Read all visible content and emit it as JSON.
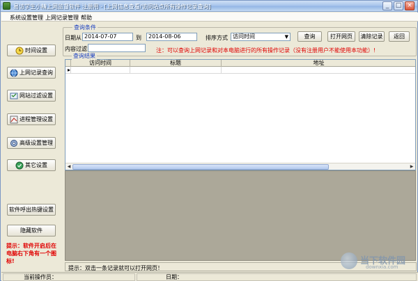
{
  "window": {
    "title": "易访学生小精上网监督软件 注册用 - [上网信息查看/访问站点所有操作记录查询]",
    "minimize": "_",
    "maximize": "□",
    "close": "×"
  },
  "menu": {
    "items": [
      "系统设置管理",
      "上网记录管理",
      "帮助"
    ]
  },
  "sidebar": {
    "buttons": [
      {
        "label": "时间设置",
        "icon": "clock-icon"
      },
      {
        "label": "上网记录查询",
        "icon": "globe-icon"
      },
      {
        "label": "网站过滤设置",
        "icon": "filter-icon"
      },
      {
        "label": "进程管理设置",
        "icon": "process-icon"
      },
      {
        "label": "高级设置管理",
        "icon": "gear-icon"
      },
      {
        "label": "其它设置",
        "icon": "other-icon"
      },
      {
        "label": "软件呼出热键设置",
        "icon": ""
      },
      {
        "label": "隐藏软件",
        "icon": ""
      }
    ],
    "hint": "提示：软件开启后在电脑右下角有一个图标!"
  },
  "query": {
    "legend": "查询条件",
    "date_from_label": "日期从",
    "date_from": "2014-07-07",
    "date_to_label": "到",
    "date_to": "2014-08-06",
    "sort_label": "排序方式",
    "sort_value": "访问时间",
    "content_filter_label": "内容过滤",
    "content_filter_value": "",
    "note": "注：可以查询上网记录和对本电脑进行的所有操作记录（没有注册用户不能使用本功能）!",
    "buttons": {
      "search": "查询",
      "open_page": "打开网页",
      "clear": "清除记录",
      "back": "返回"
    }
  },
  "results": {
    "legend": "查询结果",
    "columns": [
      "访问时间",
      "标题",
      "地址"
    ],
    "row_indicator": "▸"
  },
  "status": {
    "tip": "提示：双击一条记录就可以打开网页！",
    "operator_label": "当前操作员：",
    "date_label": "日期："
  },
  "watermark": {
    "text": "当下软件园",
    "sub": "downxia.com"
  }
}
